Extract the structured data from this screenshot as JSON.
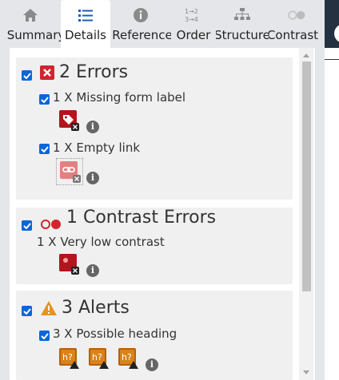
{
  "tabs": [
    {
      "label": "Summary",
      "icon": "home-icon",
      "active": false
    },
    {
      "label": "Details",
      "icon": "list-icon",
      "active": true
    },
    {
      "label": "Reference",
      "icon": "info-icon",
      "active": false
    },
    {
      "label": "Order",
      "icon": "order-icon",
      "active": false
    },
    {
      "label": "Structure",
      "icon": "structure-icon",
      "active": false
    },
    {
      "label": "Contrast",
      "icon": "contrast-icon",
      "active": false
    }
  ],
  "errors": {
    "heading": "2 Errors",
    "items": [
      {
        "label": "1 X Missing form label",
        "icon": "missing-form-label-icon"
      },
      {
        "label": "1 X Empty link",
        "icon": "empty-link-icon"
      }
    ]
  },
  "contrast": {
    "heading": "1 Contrast Errors",
    "items": [
      {
        "label": "1 X Very low contrast",
        "icon": "very-low-contrast-icon"
      }
    ]
  },
  "alerts": {
    "heading": "3 Alerts",
    "items": [
      {
        "label": "3 X Possible heading",
        "icon": "possible-heading-icon",
        "badge": "h?"
      }
    ]
  },
  "colors": {
    "accent": "#0b66d6",
    "error": "#d0252f",
    "alert": "#e6931f",
    "panel": "#e4e6ea"
  }
}
